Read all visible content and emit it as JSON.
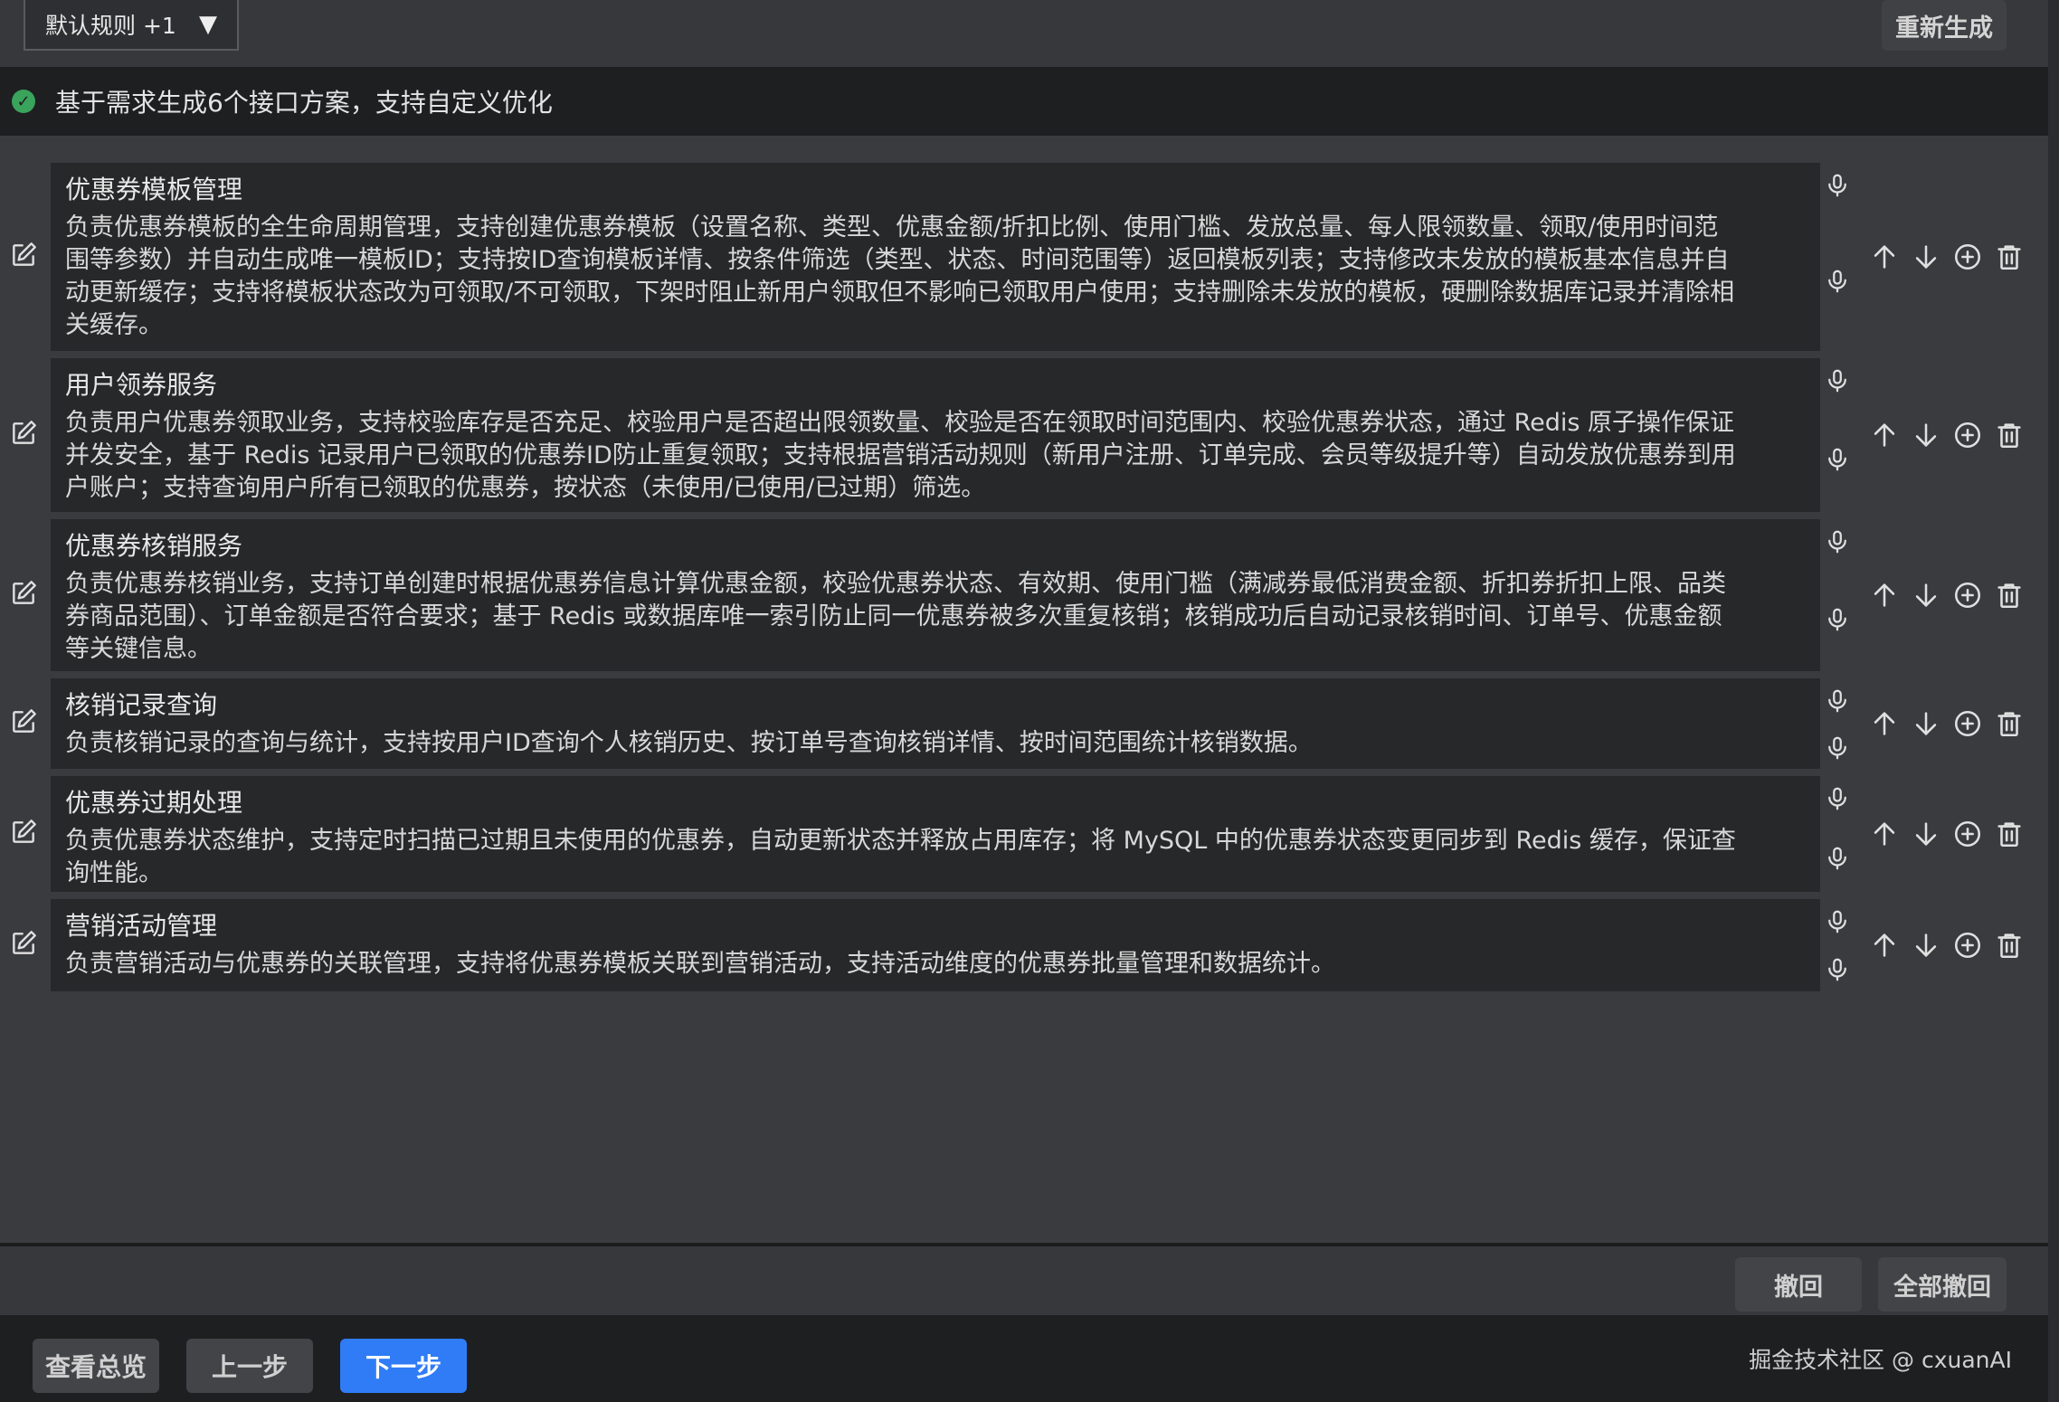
{
  "header": {
    "rule_select": "默认规则 +1",
    "rule_arrow": "▼",
    "regenerate_label": "重新生成"
  },
  "status": {
    "text": "基于需求生成6个接口方案，支持自定义优化",
    "color": "#3aa35c"
  },
  "items": [
    {
      "title": "优惠券模板管理",
      "lines": [
        "负责优惠券模板的全生命周期管理，支持创建优惠券模板（设置名称、类型、优惠金额/折扣比例、使用门槛、发放总量、每人限领数量、领取/使用时间范",
        "围等参数）并自动生成唯一模板ID；支持按ID查询模板详情、按条件筛选（类型、状态、时间范围等）返回模板列表；支持修改未发放的模板基本信息并自",
        "动更新缓存；支持将模板状态改为可领取/不可领取，下架时阻止新用户领取但不影响已领取用户使用；支持删除未发放的模板，硬删除数据库记录并清除相",
        "关缓存。"
      ]
    },
    {
      "title": "用户领券服务",
      "lines": [
        "负责用户优惠券领取业务，支持校验库存是否充足、校验用户是否超出限领数量、校验是否在领取时间范围内、校验优惠券状态，通过 Redis 原子操作保证",
        "并发安全，基于 Redis 记录用户已领取的优惠券ID防止重复领取；支持根据营销活动规则（新用户注册、订单完成、会员等级提升等）自动发放优惠券到用",
        "户账户；支持查询用户所有已领取的优惠券，按状态（未使用/已使用/已过期）筛选。"
      ]
    },
    {
      "title": "优惠券核销服务",
      "lines": [
        "负责优惠券核销业务，支持订单创建时根据优惠券信息计算优惠金额，校验优惠券状态、有效期、使用门槛（满减券最低消费金额、折扣券折扣上限、品类",
        "券商品范围）、订单金额是否符合要求；基于 Redis 或数据库唯一索引防止同一优惠券被多次重复核销；核销成功后自动记录核销时间、订单号、优惠金额",
        "等关键信息。"
      ]
    },
    {
      "title": "核销记录查询",
      "lines": [
        "负责核销记录的查询与统计，支持按用户ID查询个人核销历史、按订单号查询核销详情、按时间范围统计核销数据。"
      ]
    },
    {
      "title": "优惠券过期处理",
      "lines": [
        "负责优惠券状态维护，支持定时扫描已过期且未使用的优惠券，自动更新状态并释放占用库存；将 MySQL 中的优惠券状态变更同步到 Redis 缓存，保证查",
        "询性能。"
      ]
    },
    {
      "title": "营销活动管理",
      "lines": [
        "负责营销活动与优惠券的关联管理，支持将优惠券模板关联到营销活动，支持活动维度的优惠券批量管理和数据统计。"
      ]
    }
  ],
  "tools": {
    "undo_label": "撤回",
    "undo_all_label": "全部撤回"
  },
  "footer": {
    "overview_label": "查看总览",
    "prev_label": "上一步",
    "next_label": "下一步",
    "watermark": "掘金技术社区 @ cxuanAI"
  }
}
